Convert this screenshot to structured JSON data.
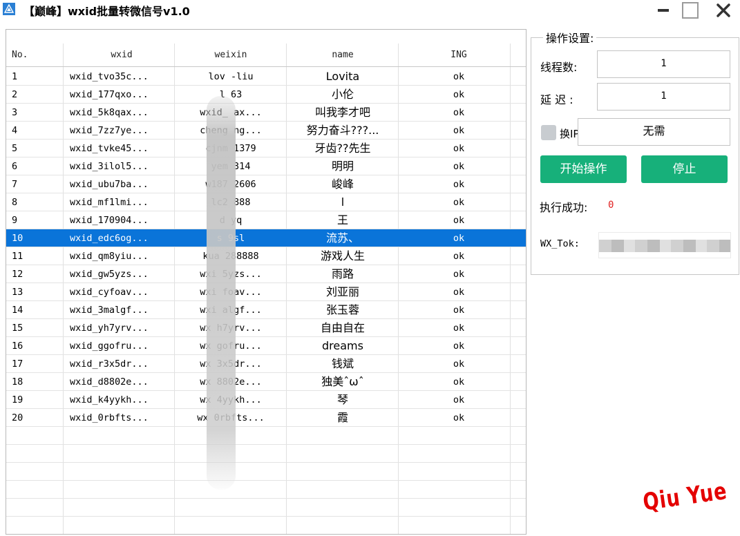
{
  "window": {
    "title": "【巅峰】wxid批量转微信号v1.0",
    "controls": {
      "minimize": "—",
      "maximize": "☐",
      "close": "✕"
    }
  },
  "table": {
    "columns": [
      "No.",
      "wxid",
      "weixin",
      "name",
      "ING"
    ],
    "selected_row": 10,
    "rows": [
      {
        "no": "1",
        "wxid": "wxid_tvo35c...",
        "weixin": "lov    -liu",
        "name": "Lovita",
        "ing": "ok"
      },
      {
        "no": "2",
        "wxid": "wxid_177qxo...",
        "weixin": "l     63",
        "name": "小伦",
        "ing": "ok"
      },
      {
        "no": "3",
        "wxid": "wxid_5k8qax...",
        "weixin": "wxid_    ax...",
        "name": "叫我李才吧",
        "ing": "ok"
      },
      {
        "no": "4",
        "wxid": "wxid_7zz7ye...",
        "weixin": "cheng    ng...",
        "name": "努力奋斗???...",
        "ing": "ok"
      },
      {
        "no": "5",
        "wxid": "wxid_tvke45...",
        "weixin": "cjnm    1379",
        "name": "牙齿??先生",
        "ing": "ok"
      },
      {
        "no": "6",
        "wxid": "wxid_3ilol5...",
        "weixin": "yem    314",
        "name": "明明",
        "ing": "ok"
      },
      {
        "no": "7",
        "wxid": "wxid_ubu7ba...",
        "weixin": "w187    2606",
        "name": "峻峰",
        "ing": "ok"
      },
      {
        "no": "8",
        "wxid": "wxid_mf1lmi...",
        "weixin": "lc2    888",
        "name": "l",
        "ing": "ok"
      },
      {
        "no": "9",
        "wxid": "wxid_170904...",
        "weixin": "d    yq",
        "name": "王",
        "ing": "ok"
      },
      {
        "no": "10",
        "wxid": "wxid_edc6og...",
        "weixin": "s    9sl",
        "name": "流苏、",
        "ing": "ok"
      },
      {
        "no": "11",
        "wxid": "wxid_qm8yiu...",
        "weixin": "kua    288888",
        "name": "游戏人生",
        "ing": "ok"
      },
      {
        "no": "12",
        "wxid": "wxid_gw5yzs...",
        "weixin": "wxi    5yzs...",
        "name": "雨路",
        "ing": "ok"
      },
      {
        "no": "13",
        "wxid": "wxid_cyfoav...",
        "weixin": "wxi    foav...",
        "name": "刘亚丽",
        "ing": "ok"
      },
      {
        "no": "14",
        "wxid": "wxid_3malgf...",
        "weixin": "wxi    algf...",
        "name": "张玉蓉",
        "ing": "ok"
      },
      {
        "no": "15",
        "wxid": "wxid_yh7yrv...",
        "weixin": "wx    h7yrv...",
        "name": "自由自在",
        "ing": "ok"
      },
      {
        "no": "16",
        "wxid": "wxid_ggofru...",
        "weixin": "wx    gofru...",
        "name": "dreams",
        "ing": "ok"
      },
      {
        "no": "17",
        "wxid": "wxid_r3x5dr...",
        "weixin": "wx    3x5dr...",
        "name": "钱斌",
        "ing": "ok"
      },
      {
        "no": "18",
        "wxid": "wxid_d8802e...",
        "weixin": "wx    8802e...",
        "name": "独美ˆωˆ",
        "ing": "ok"
      },
      {
        "no": "19",
        "wxid": "wxid_k4yykh...",
        "weixin": "wx    4yykh...",
        "name": "琴",
        "ing": "ok"
      },
      {
        "no": "20",
        "wxid": "wxid_0rbfts...",
        "weixin": "wx    0rbfts...",
        "name": "霞",
        "ing": "ok"
      }
    ]
  },
  "settings": {
    "group_title": "操作设置:",
    "threads_label": "线程数:",
    "threads_value": "1",
    "delay_label": "延 迟 :",
    "delay_value": "1",
    "change_ip_label": "换IP",
    "change_ip_value": "无需",
    "start_button": "开始操作",
    "stop_button": "停止",
    "success_label": "执行成功:",
    "success_count": "0",
    "token_label": "WX_Tok:"
  },
  "watermark": "Qiu Yue",
  "colors": {
    "selected_row": "#0a74d9",
    "button_green": "#17b07a",
    "success_count": "#e02020",
    "watermark": "#e40000"
  }
}
